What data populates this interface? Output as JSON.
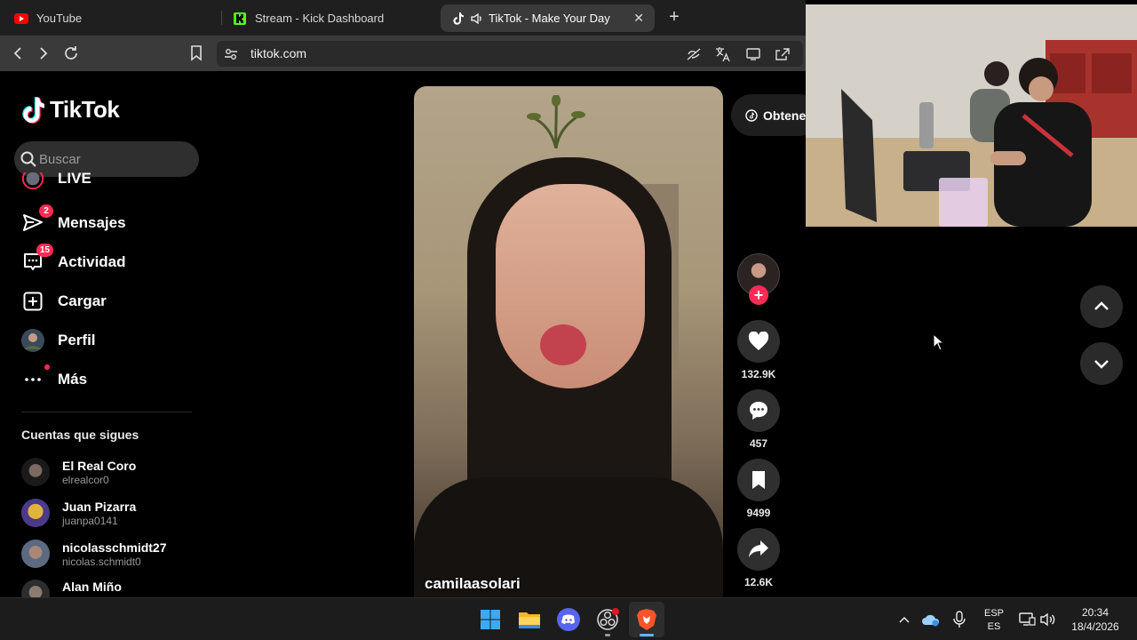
{
  "browser": {
    "tabs": [
      {
        "label": "YouTube",
        "icon": "youtube-icon"
      },
      {
        "label": "Stream - Kick Dashboard",
        "icon": "kick-icon"
      },
      {
        "label": "TikTok - Make Your Day",
        "icon": "tiktok-icon",
        "active": true,
        "audio": true
      }
    ],
    "address": "tiktok.com"
  },
  "tiktok": {
    "logo": "TikTok",
    "search_placeholder": "Buscar",
    "nav": [
      {
        "label": "LIVE",
        "icon": "live-icon"
      },
      {
        "label": "Mensajes",
        "icon": "messages-icon",
        "badge": "2"
      },
      {
        "label": "Actividad",
        "icon": "activity-icon",
        "badge": "15"
      },
      {
        "label": "Cargar",
        "icon": "upload-icon"
      },
      {
        "label": "Perfil",
        "icon": "profile-icon"
      },
      {
        "label": "Más",
        "icon": "more-icon"
      }
    ],
    "following_title": "Cuentas que sigues",
    "following": [
      {
        "name": "El Real Coro",
        "username": "elrealcor0"
      },
      {
        "name": "Juan Pizarra",
        "username": "juanpa0141"
      },
      {
        "name": "nicolasschmidt27",
        "username": "nicolas.schmidt0"
      },
      {
        "name": "Alan Miño",
        "username": ""
      }
    ],
    "video": {
      "author": "camilaasolari",
      "likes": "132.9K",
      "comments": "457",
      "saves": "9499",
      "shares": "12.6K"
    },
    "get_app_label": "Obtene",
    "colors": {
      "accent": "#fe2c55",
      "background": "#000000"
    }
  },
  "taskbar": {
    "lang_top": "ESP",
    "lang_bottom": "ES",
    "time": "20:34",
    "date": "18/4/2026"
  }
}
